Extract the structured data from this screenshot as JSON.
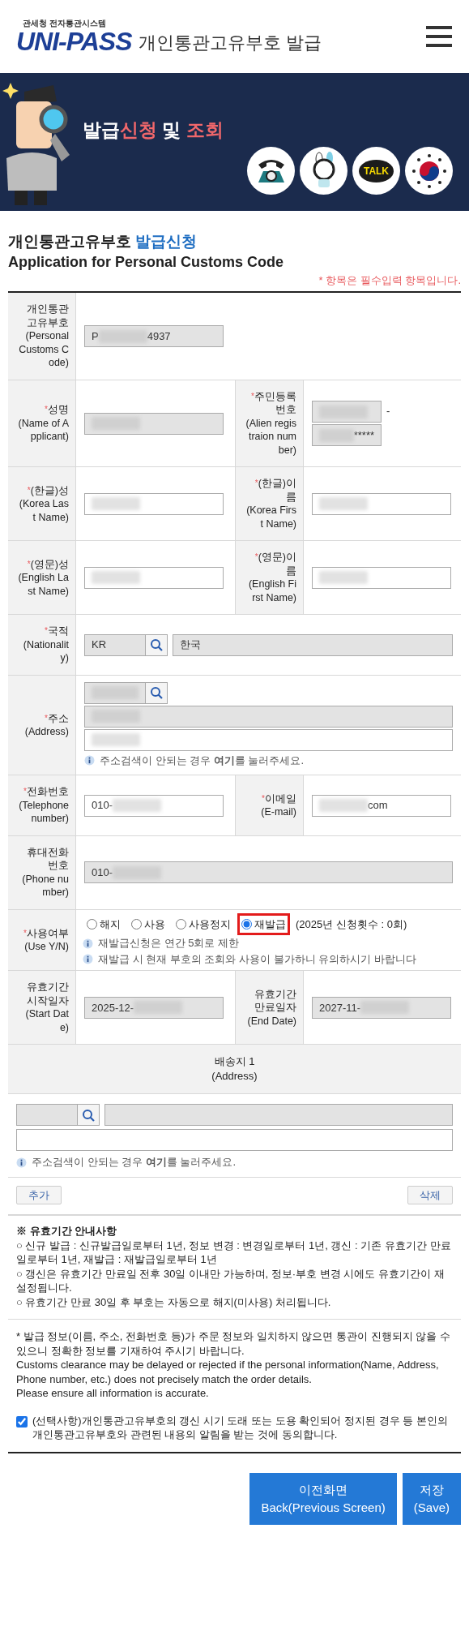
{
  "header": {
    "logo_caption": "관세청 전자통관시스템",
    "logo_text": "UNI-PASS",
    "title": "개인통관고유부호 발급"
  },
  "banner": {
    "title": [
      {
        "text": "발급",
        "highlight": false
      },
      {
        "text": "신청",
        "highlight": true
      },
      {
        "text": " 및 ",
        "highlight": false
      },
      {
        "text": "조회",
        "highlight": true
      }
    ],
    "quick_icons": [
      {
        "kind": "phone"
      },
      {
        "kind": "mascot"
      },
      {
        "kind": "talk",
        "text": "TALK"
      },
      {
        "kind": "emblem"
      }
    ]
  },
  "page_title": {
    "prefix": "개인통관고유부호",
    "accent": "발급신청",
    "english": "Application for Personal Customs Code"
  },
  "required_note": "* 항목은 필수입력 항목입니다.",
  "form_rows": [
    {
      "kind": "single",
      "cells": [
        {
          "label": {
            "ko": "개인통관고유부호",
            "en": "(Personal Customs Code)"
          },
          "lines": [
            [
              {
                "kind": "readonly",
                "wide": false,
                "parts": [
                  {
                    "kind": "text",
                    "text": "P"
                  },
                  {
                    "kind": "blur"
                  },
                  {
                    "kind": "text",
                    "text": "4937"
                  }
                ]
              }
            ]
          ]
        }
      ]
    },
    {
      "kind": "pair",
      "cells": [
        {
          "label": {
            "marker": "*",
            "ko": "성명",
            "en": "(Name of Applicant)"
          },
          "lines": [
            [
              {
                "kind": "readonly",
                "wide": false,
                "parts": [
                  {
                    "kind": "blur"
                  }
                ]
              }
            ]
          ]
        },
        {
          "label": {
            "marker": "*",
            "ko": "주민등록번호",
            "en": "(Alien registraion number)"
          },
          "lines": [
            [
              {
                "kind": "readonly",
                "wide": false,
                "compact": true,
                "parts": [
                  {
                    "kind": "blur"
                  }
                ]
              },
              {
                "kind": "separator",
                "text": "-"
              }
            ],
            [
              {
                "kind": "readonly",
                "wide": false,
                "compact": true,
                "parts": [
                  {
                    "kind": "blur"
                  },
                  {
                    "kind": "text",
                    "text": "*****"
                  }
                ]
              }
            ]
          ]
        }
      ]
    },
    {
      "kind": "pair",
      "cells": [
        {
          "label": {
            "marker": "*",
            "ko": "(한글)성",
            "en": "(Korea Last Name)"
          },
          "lines": [
            [
              {
                "kind": "input",
                "wide": false,
                "parts": [
                  {
                    "kind": "blur"
                  }
                ]
              }
            ]
          ]
        },
        {
          "label": {
            "marker": "*",
            "ko": "(한글)이름",
            "en": "(Korea First Name)"
          },
          "lines": [
            [
              {
                "kind": "input",
                "wide": false,
                "parts": [
                  {
                    "kind": "blur"
                  }
                ]
              }
            ]
          ]
        }
      ]
    },
    {
      "kind": "pair",
      "cells": [
        {
          "label": {
            "marker": "*",
            "ko": "(영문)성",
            "en": "(English Last Name)"
          },
          "lines": [
            [
              {
                "kind": "input",
                "wide": false,
                "parts": [
                  {
                    "kind": "blur"
                  }
                ]
              }
            ]
          ]
        },
        {
          "label": {
            "marker": "*",
            "ko": "(영문)이름",
            "en": "(English First Name)"
          },
          "lines": [
            [
              {
                "kind": "input",
                "wide": false,
                "parts": [
                  {
                    "kind": "blur"
                  }
                ]
              }
            ]
          ]
        }
      ]
    },
    {
      "kind": "single",
      "cells": [
        {
          "label": {
            "marker": "*",
            "ko": "국적",
            "en": "(Nationality)"
          },
          "lines": [
            [
              {
                "kind": "lookup",
                "parts": [
                  {
                    "kind": "text",
                    "text": "KR"
                  }
                ]
              },
              {
                "kind": "readonly",
                "wide": true,
                "parts": [
                  {
                    "kind": "text",
                    "text": "한국"
                  }
                ]
              }
            ]
          ]
        }
      ]
    },
    {
      "kind": "single",
      "cells": [
        {
          "label": {
            "marker": "*",
            "ko": "주소",
            "en": "(Address)"
          },
          "lines": [
            [
              {
                "kind": "lookup",
                "parts": [
                  {
                    "kind": "blur"
                  }
                ]
              }
            ],
            [
              {
                "kind": "readonly",
                "wide": true,
                "parts": [
                  {
                    "kind": "blur"
                  }
                ]
              }
            ],
            [
              {
                "kind": "input",
                "wide": true,
                "parts": [
                  {
                    "kind": "blur"
                  }
                ]
              }
            ]
          ],
          "note": {
            "before": "주소검색이 안되는 경우 ",
            "link": "여기",
            "after": "를 눌러주세요."
          }
        }
      ]
    },
    {
      "kind": "pair",
      "cells": [
        {
          "label": {
            "marker": "*",
            "ko": "전화번호",
            "en": "(Telephone number)"
          },
          "lines": [
            [
              {
                "kind": "input",
                "wide": false,
                "parts": [
                  {
                    "kind": "text",
                    "text": "010-"
                  },
                  {
                    "kind": "blur"
                  }
                ]
              }
            ]
          ]
        },
        {
          "label": {
            "marker": "*",
            "ko": "이메일",
            "en": "(E-mail)"
          },
          "lines": [
            [
              {
                "kind": "input",
                "wide": false,
                "parts": [
                  {
                    "kind": "blur"
                  },
                  {
                    "kind": "text",
                    "text": "com"
                  }
                ]
              }
            ]
          ]
        }
      ]
    },
    {
      "kind": "single",
      "cells": [
        {
          "label": {
            "ko": "휴대전화번호",
            "en": "(Phone number)"
          },
          "lines": [
            [
              {
                "kind": "readonly",
                "wide": true,
                "parts": [
                  {
                    "kind": "text",
                    "text": "010-"
                  },
                  {
                    "kind": "blur"
                  }
                ]
              }
            ]
          ]
        }
      ]
    },
    {
      "kind": "radio",
      "cells": [
        {
          "label": {
            "marker": "*",
            "ko": "사용여부",
            "en": "(Use Y/N)"
          },
          "options": [
            {
              "label": "해지",
              "selected": false,
              "highlighted": false
            },
            {
              "label": "사용",
              "selected": false,
              "highlighted": false
            },
            {
              "label": "사용정지",
              "selected": false,
              "highlighted": false
            },
            {
              "label": "재발급",
              "selected": true,
              "highlighted": true
            }
          ],
          "count_note": "(2025년 신청횟수 : 0회)",
          "info": [
            "재발급신청은 연간 5회로 제한",
            "재발급 시 현재 부호의 조회와 사용이 불가하니 유의하시기 바랍니다"
          ]
        }
      ]
    },
    {
      "kind": "pair",
      "cells": [
        {
          "label": {
            "ko": "유효기간시작일자",
            "en": "(Start Date)"
          },
          "lines": [
            [
              {
                "kind": "readonly",
                "wide": false,
                "parts": [
                  {
                    "kind": "text",
                    "text": "2025-12-"
                  },
                  {
                    "kind": "blur"
                  }
                ]
              }
            ]
          ]
        },
        {
          "label": {
            "ko": "유효기간만료일자",
            "en": "(End Date)"
          },
          "lines": [
            [
              {
                "kind": "readonly",
                "wide": false,
                "parts": [
                  {
                    "kind": "text",
                    "text": "2027-11-"
                  },
                  {
                    "kind": "blur"
                  }
                ]
              }
            ]
          ]
        }
      ]
    }
  ],
  "delivery": {
    "title": "배송지 1",
    "subtitle": "(Address)",
    "lines": [
      [
        {
          "kind": "lookup"
        },
        {
          "kind": "readonly",
          "wide": true
        }
      ],
      [
        {
          "kind": "input",
          "wide": true
        }
      ]
    ],
    "note": {
      "before": "주소검색이 안되는 경우 ",
      "link": "여기",
      "after": "를 눌러주세요."
    },
    "buttons": [
      "추가",
      "삭제"
    ]
  },
  "validity": {
    "title": "※ 유효기간 안내사항",
    "items": [
      "○ 신규 발급 : 신규발급일로부터 1년, 정보 변경 : 변경일로부터 1년, 갱신 : 기존 유효기간 만료일로부터 1년, 재발급 : 재발급일로부터 1년",
      "○ 갱신은 유효기간 만료일 전후 30일 이내만 가능하며, 정보·부호 변경 시에도 유효기간이 재설정됩니다.",
      "○ 유효기간 만료 30일 후 부호는 자동으로 해지(미사용) 처리됩니다."
    ]
  },
  "disclaimer": {
    "ko": "* 발급 정보(이름, 주소, 전화번호 등)가 주문 정보와 일치하지 않으면 통관이 진행되지 않을 수 있으니 정확한 정보를 기재하여 주시기 바랍니다.",
    "en": [
      "Customs clearance may be delayed or rejected if the personal information(Name, Address, Phone number, etc.) does not precisely match the order details.",
      "Please ensure all information is accurate."
    ]
  },
  "consent": {
    "checked": true,
    "text": "(선택사항)개인통관고유부호의 갱신 시기 도래 또는 도용 확인되어 정지된 경우 등 본인의 개인통관고유부호와 관련된 내용의 알림을 받는 것에 동의합니다."
  },
  "actions": [
    {
      "ko": "이전화면",
      "en": "Back(Previous Screen)"
    },
    {
      "ko": "저장",
      "en": "(Save)"
    }
  ]
}
